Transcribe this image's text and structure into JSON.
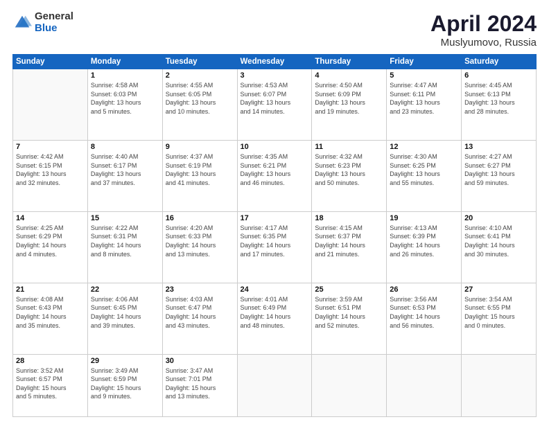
{
  "logo": {
    "general": "General",
    "blue": "Blue"
  },
  "header": {
    "title": "April 2024",
    "subtitle": "Muslyumovo, Russia"
  },
  "weekdays": [
    "Sunday",
    "Monday",
    "Tuesday",
    "Wednesday",
    "Thursday",
    "Friday",
    "Saturday"
  ],
  "weeks": [
    [
      {
        "day": "",
        "info": ""
      },
      {
        "day": "1",
        "info": "Sunrise: 4:58 AM\nSunset: 6:03 PM\nDaylight: 13 hours\nand 5 minutes."
      },
      {
        "day": "2",
        "info": "Sunrise: 4:55 AM\nSunset: 6:05 PM\nDaylight: 13 hours\nand 10 minutes."
      },
      {
        "day": "3",
        "info": "Sunrise: 4:53 AM\nSunset: 6:07 PM\nDaylight: 13 hours\nand 14 minutes."
      },
      {
        "day": "4",
        "info": "Sunrise: 4:50 AM\nSunset: 6:09 PM\nDaylight: 13 hours\nand 19 minutes."
      },
      {
        "day": "5",
        "info": "Sunrise: 4:47 AM\nSunset: 6:11 PM\nDaylight: 13 hours\nand 23 minutes."
      },
      {
        "day": "6",
        "info": "Sunrise: 4:45 AM\nSunset: 6:13 PM\nDaylight: 13 hours\nand 28 minutes."
      }
    ],
    [
      {
        "day": "7",
        "info": "Sunrise: 4:42 AM\nSunset: 6:15 PM\nDaylight: 13 hours\nand 32 minutes."
      },
      {
        "day": "8",
        "info": "Sunrise: 4:40 AM\nSunset: 6:17 PM\nDaylight: 13 hours\nand 37 minutes."
      },
      {
        "day": "9",
        "info": "Sunrise: 4:37 AM\nSunset: 6:19 PM\nDaylight: 13 hours\nand 41 minutes."
      },
      {
        "day": "10",
        "info": "Sunrise: 4:35 AM\nSunset: 6:21 PM\nDaylight: 13 hours\nand 46 minutes."
      },
      {
        "day": "11",
        "info": "Sunrise: 4:32 AM\nSunset: 6:23 PM\nDaylight: 13 hours\nand 50 minutes."
      },
      {
        "day": "12",
        "info": "Sunrise: 4:30 AM\nSunset: 6:25 PM\nDaylight: 13 hours\nand 55 minutes."
      },
      {
        "day": "13",
        "info": "Sunrise: 4:27 AM\nSunset: 6:27 PM\nDaylight: 13 hours\nand 59 minutes."
      }
    ],
    [
      {
        "day": "14",
        "info": "Sunrise: 4:25 AM\nSunset: 6:29 PM\nDaylight: 14 hours\nand 4 minutes."
      },
      {
        "day": "15",
        "info": "Sunrise: 4:22 AM\nSunset: 6:31 PM\nDaylight: 14 hours\nand 8 minutes."
      },
      {
        "day": "16",
        "info": "Sunrise: 4:20 AM\nSunset: 6:33 PM\nDaylight: 14 hours\nand 13 minutes."
      },
      {
        "day": "17",
        "info": "Sunrise: 4:17 AM\nSunset: 6:35 PM\nDaylight: 14 hours\nand 17 minutes."
      },
      {
        "day": "18",
        "info": "Sunrise: 4:15 AM\nSunset: 6:37 PM\nDaylight: 14 hours\nand 21 minutes."
      },
      {
        "day": "19",
        "info": "Sunrise: 4:13 AM\nSunset: 6:39 PM\nDaylight: 14 hours\nand 26 minutes."
      },
      {
        "day": "20",
        "info": "Sunrise: 4:10 AM\nSunset: 6:41 PM\nDaylight: 14 hours\nand 30 minutes."
      }
    ],
    [
      {
        "day": "21",
        "info": "Sunrise: 4:08 AM\nSunset: 6:43 PM\nDaylight: 14 hours\nand 35 minutes."
      },
      {
        "day": "22",
        "info": "Sunrise: 4:06 AM\nSunset: 6:45 PM\nDaylight: 14 hours\nand 39 minutes."
      },
      {
        "day": "23",
        "info": "Sunrise: 4:03 AM\nSunset: 6:47 PM\nDaylight: 14 hours\nand 43 minutes."
      },
      {
        "day": "24",
        "info": "Sunrise: 4:01 AM\nSunset: 6:49 PM\nDaylight: 14 hours\nand 48 minutes."
      },
      {
        "day": "25",
        "info": "Sunrise: 3:59 AM\nSunset: 6:51 PM\nDaylight: 14 hours\nand 52 minutes."
      },
      {
        "day": "26",
        "info": "Sunrise: 3:56 AM\nSunset: 6:53 PM\nDaylight: 14 hours\nand 56 minutes."
      },
      {
        "day": "27",
        "info": "Sunrise: 3:54 AM\nSunset: 6:55 PM\nDaylight: 15 hours\nand 0 minutes."
      }
    ],
    [
      {
        "day": "28",
        "info": "Sunrise: 3:52 AM\nSunset: 6:57 PM\nDaylight: 15 hours\nand 5 minutes."
      },
      {
        "day": "29",
        "info": "Sunrise: 3:49 AM\nSunset: 6:59 PM\nDaylight: 15 hours\nand 9 minutes."
      },
      {
        "day": "30",
        "info": "Sunrise: 3:47 AM\nSunset: 7:01 PM\nDaylight: 15 hours\nand 13 minutes."
      },
      {
        "day": "",
        "info": ""
      },
      {
        "day": "",
        "info": ""
      },
      {
        "day": "",
        "info": ""
      },
      {
        "day": "",
        "info": ""
      }
    ]
  ]
}
